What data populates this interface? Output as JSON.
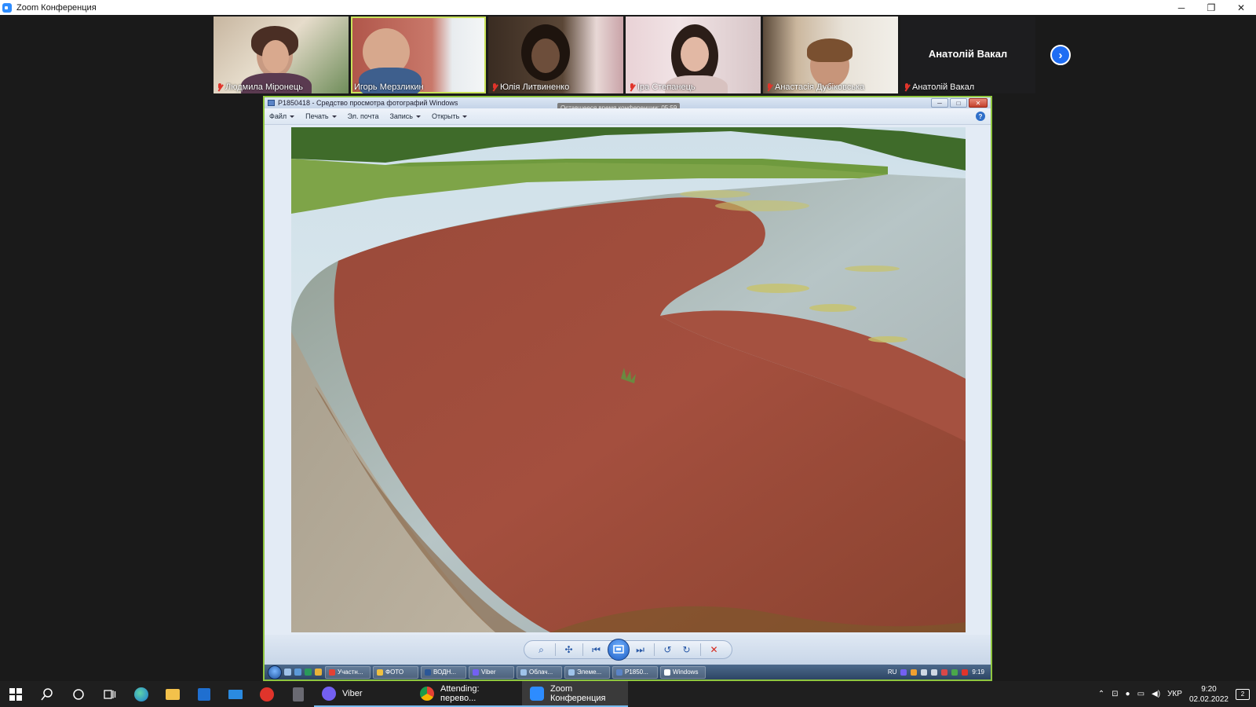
{
  "zoom": {
    "title": "Zoom Конференция",
    "controls": {
      "minimize": "─",
      "restore": "❐",
      "close": "✕"
    }
  },
  "participants": [
    {
      "name": "Людмила Міронець",
      "muted": true
    },
    {
      "name": "Игорь Мерзликин",
      "muted": false,
      "active": true
    },
    {
      "name": "Юлія Литвиненко",
      "muted": true
    },
    {
      "name": "Іра Степанець",
      "muted": true
    },
    {
      "name": "Анастасія Дубіковська",
      "muted": true
    },
    {
      "name": "Анатолій Вакал",
      "muted": true,
      "display_name": "Анатолій Вакал"
    }
  ],
  "next_arrow": "›",
  "photo_viewer": {
    "title": "P1850418 - Средство просмотра фотографий Windows",
    "tooltip": "Оставшееся время конференции: 05:59",
    "menu": [
      {
        "label": "Файл",
        "has_caret": true
      },
      {
        "label": "Печать",
        "has_caret": true
      },
      {
        "label": "Эл. почта",
        "has_caret": false
      },
      {
        "label": "Запись",
        "has_caret": true
      },
      {
        "label": "Открыть",
        "has_caret": true
      }
    ],
    "help": "?",
    "winbtns": {
      "min": "─",
      "max": "□",
      "close": "✕"
    },
    "controls": {
      "zoom": "⌕",
      "fit": "✣",
      "prev": "⏮",
      "next": "⏭",
      "rot_ccw": "↺",
      "rot_cw": "↻",
      "delete": "✕"
    }
  },
  "inner_taskbar": {
    "tasks": [
      "Участн...",
      "ФОТО",
      "ВОДН...",
      "Viber",
      "Облач...",
      "Элеме...",
      "P1850...",
      "Windows"
    ],
    "lang": "RU",
    "time": "9:19"
  },
  "taskbar": {
    "apps": [
      {
        "label": "Viber",
        "color": "#7360f2",
        "active": false
      },
      {
        "label": "Attending: перево...",
        "color": "#e44134",
        "active": false
      },
      {
        "label": "Zoom Конференция",
        "color": "#2d8cff",
        "active": true
      }
    ],
    "lang": "УКР",
    "time": "9:20",
    "date": "02.02.2022",
    "notifications": "2"
  },
  "colors": {
    "zoom_accent": "#2d8cff",
    "active_speaker": "#c9e25a",
    "share_border": "#8fc63f"
  }
}
